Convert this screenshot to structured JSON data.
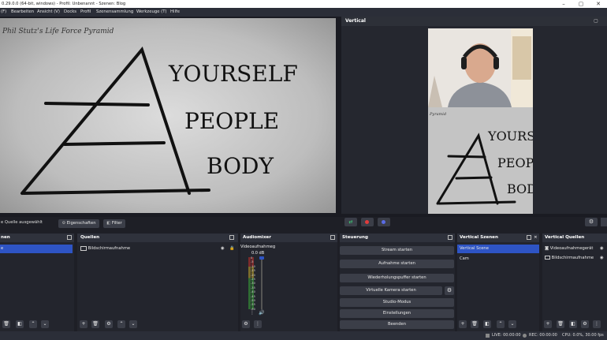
{
  "titlebar": {
    "title": "0.29.0.0 (64-bit, windows) - Profil: Unbenannt - Szenen: Blog"
  },
  "menu": {
    "items": [
      "(F)",
      "Bearbeiten",
      "Ansicht (V)",
      "Docks",
      "Profil",
      "Szenensammlung",
      "Werkzeuge (T)",
      "Hilfe"
    ]
  },
  "preview": {
    "drawing_title": "Phil Stutz's Life Force Pyramid",
    "words": [
      "YOURSELF",
      "PEOPLE",
      "BODY"
    ]
  },
  "vertical": {
    "title": "Vertical",
    "small_title": "Pyramid"
  },
  "source_bar": {
    "no_source": "e Quelle ausgewählt",
    "properties": "Eigenschaften",
    "filter": "Filter"
  },
  "scenes_panel": {
    "title": "nen"
  },
  "sources_panel": {
    "title": "Quellen",
    "items": [
      {
        "label": "Bildschirmaufnahme"
      }
    ]
  },
  "mixer": {
    "title": "Audiomixer",
    "channel": "Videoaufnahmeg",
    "db": "0.0 dB",
    "ticks": [
      "0",
      "-5",
      "-10",
      "-15",
      "-20",
      "-25",
      "-30",
      "-35",
      "-40",
      "-45",
      "-50",
      "-55",
      "-60"
    ]
  },
  "controls": {
    "title": "Steuerung",
    "buttons": [
      "Stream starten",
      "Aufnahme starten",
      "Wiederholungspuffer starten",
      "Virtuelle Kamera starten",
      "Studio-Modus",
      "Einstellungen",
      "Beenden"
    ]
  },
  "vscenes": {
    "title": "Vertical Szenen",
    "items": [
      "Vertical Scene",
      "Cam"
    ]
  },
  "vsources": {
    "title": "Vertical Quellen",
    "items": [
      "Videoaufnahmegerät",
      "Bildschirmaufnahme"
    ]
  },
  "status": {
    "live": "LIVE: 00:00:00",
    "rec": "REC: 00:00:00",
    "cpu": "CPU: 0.0%, 30.00 fps"
  },
  "colors": {
    "accent": "#2e54c4",
    "panel": "#23252d",
    "header": "#2f323c"
  }
}
